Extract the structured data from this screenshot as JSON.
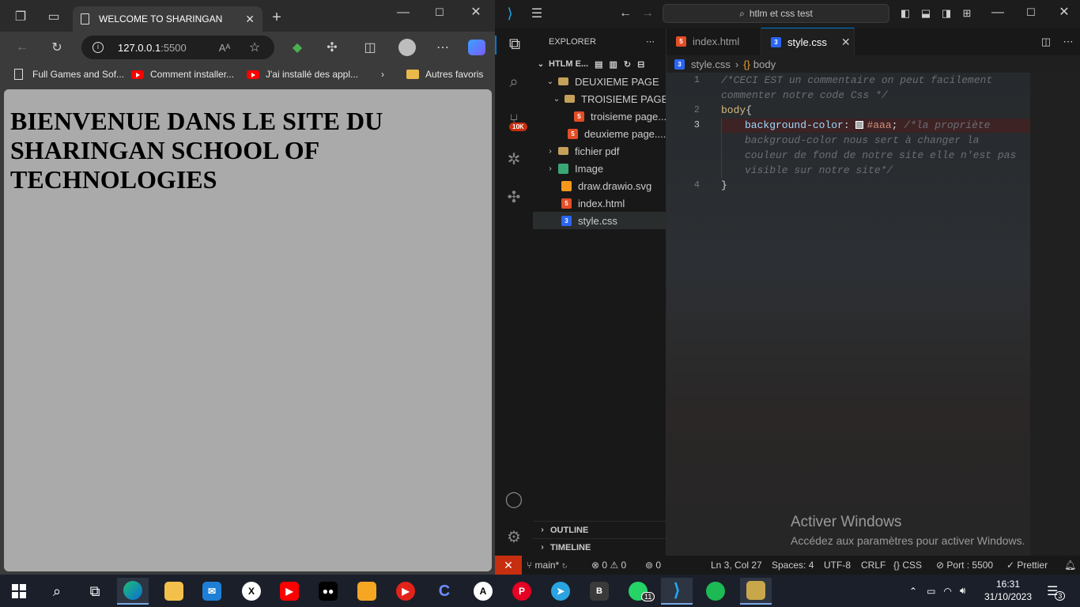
{
  "browser": {
    "tab_title": "WELCOME TO SHARINGAN",
    "url_host": "127.0.0.1",
    "url_port": ":5500",
    "bookmarks": [
      "Full Games and Sof...",
      "Comment installer...",
      "J'ai installé des appl..."
    ],
    "other_favorites": "Autres favoris",
    "page_heading": "BIENVENUE DANS LE SITE DU SHARINGAN SCHOOL OF TECHNOLOGIES",
    "page_bg": "#aaaaaa"
  },
  "vscode": {
    "search": "htlm et css test",
    "explorer_label": "EXPLORER",
    "project": "HTLM E...",
    "tree": [
      {
        "label": "DEUXIEME PAGE",
        "type": "folder",
        "open": true
      },
      {
        "label": "TROISIEME PAGE",
        "type": "folder",
        "open": true
      },
      {
        "label": "troisieme page....",
        "type": "html"
      },
      {
        "label": "deuxieme page....",
        "type": "html"
      },
      {
        "label": "fichier pdf",
        "type": "folder",
        "open": false
      },
      {
        "label": "Image",
        "type": "img-folder",
        "open": false
      },
      {
        "label": "draw.drawio.svg",
        "type": "svg"
      },
      {
        "label": "index.html",
        "type": "html"
      },
      {
        "label": "style.css",
        "type": "css"
      }
    ],
    "outline": "OUTLINE",
    "timeline": "TIMELINE",
    "source_control_badge": "10K",
    "tabs": [
      {
        "label": "index.html",
        "active": false
      },
      {
        "label": "style.css",
        "active": true
      }
    ],
    "breadcrumb_file": "style.css",
    "breadcrumb_symbol": "body",
    "line_numbers": [
      "1",
      "2",
      "3",
      "4"
    ],
    "code": {
      "l1a": "/*CECI EST un commentaire on peut facilement",
      "l1b": "commenter notre code Css */",
      "l2_sel": "body",
      "l2_brace": "{",
      "l3_prop": "background-color",
      "l3_colon": ": ",
      "l3_val": "#aaa",
      "l3_semi": "; ",
      "l3_comment_a": "/*la propriète",
      "l3_comment_b": "backgroud-color nous sert à changer la",
      "l3_comment_c": "couleur de fond de notre site elle n'est pas",
      "l3_comment_d": "visible sur notre site*/",
      "l4": "}"
    },
    "watermark_title": "Activer Windows",
    "watermark_sub": "Accédez aux paramètres pour activer Windows.",
    "status": {
      "branch": "main*",
      "errors": "0",
      "warnings": "0",
      "ports_count": "0",
      "position": "Ln 3, Col 27",
      "spaces": "Spaces: 4",
      "encoding": "UTF-8",
      "eol": "CRLF",
      "language": "CSS",
      "port": "Port : 5500",
      "formatter": "Prettier"
    }
  },
  "taskbar": {
    "time": "16:31",
    "date": "31/10/2023",
    "whatsapp_badge": "11",
    "notif_count": "3"
  }
}
